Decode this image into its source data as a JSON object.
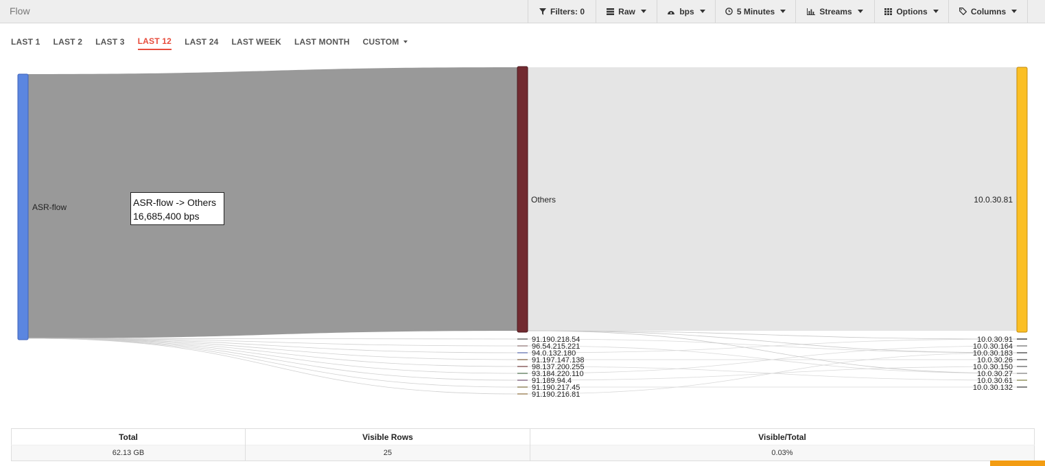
{
  "app": {
    "title": "Flow"
  },
  "toolbar": {
    "filters_label": "Filters: 0",
    "raw_label": "Raw",
    "bps_label": "bps",
    "interval_label": "5 Minutes",
    "streams_label": "Streams",
    "options_label": "Options",
    "columns_label": "Columns"
  },
  "tabs": [
    "LAST 1",
    "LAST 2",
    "LAST 3",
    "LAST 12",
    "LAST 24",
    "LAST WEEK",
    "LAST MONTH",
    "CUSTOM"
  ],
  "active_tab": "LAST 12",
  "sankey": {
    "source": "ASR-flow",
    "middle": "Others",
    "target": "10.0.30.81",
    "middle_leaves": [
      "91.190.218.54",
      "96.54.215.221",
      "94.0.132.180",
      "91.197.147.138",
      "98.137.200.255",
      "93.184.220.110",
      "91.189.94.4",
      "91.190.217.45",
      "91.190.216.81"
    ],
    "target_leaves": [
      "10.0.30.91",
      "10.0.30.164",
      "10.0.30.183",
      "10.0.30.26",
      "10.0.30.150",
      "10.0.30.27",
      "10.0.30.61",
      "10.0.30.132"
    ],
    "colors": {
      "source_node": "#5b86e0",
      "middle_node": "#722b31",
      "target_node": "#fbbf24",
      "main_link": "#999999",
      "others_link": "#e5e5e5"
    }
  },
  "tooltip": {
    "line1": "ASR-flow -> Others",
    "line2": "16,685,400 bps"
  },
  "summary": {
    "headers": [
      "Total",
      "Visible Rows",
      "Visible/Total"
    ],
    "values": [
      "62.13 GB",
      "25",
      "0.03%"
    ]
  }
}
